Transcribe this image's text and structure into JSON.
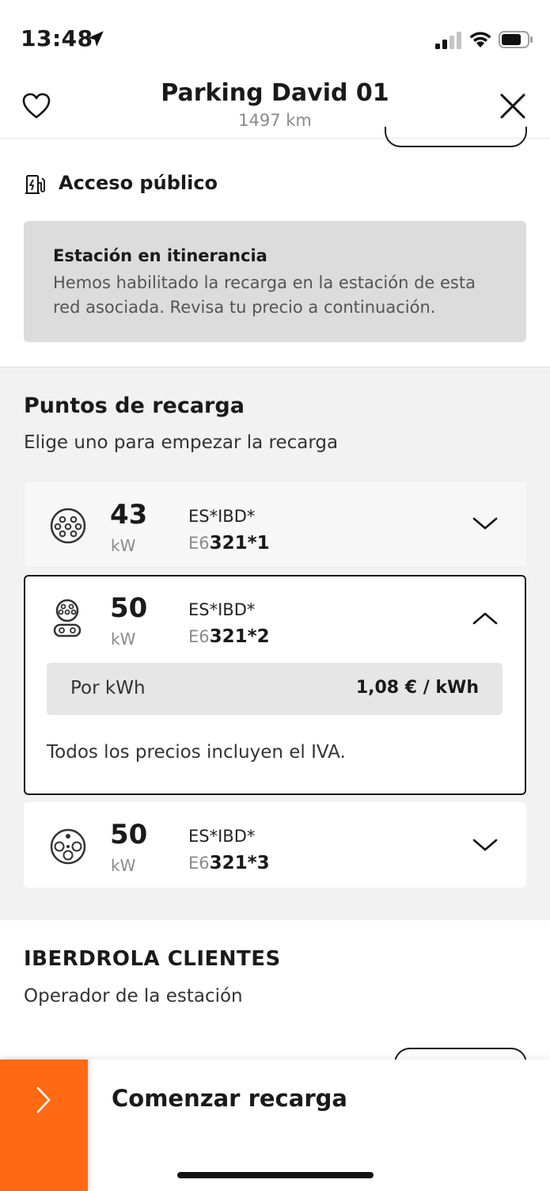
{
  "status_bar": {
    "time": "13:48"
  },
  "header": {
    "title": "Parking David 01",
    "distance": "1497 km"
  },
  "access": {
    "label": "Acceso público"
  },
  "roaming": {
    "title": "Estación en itinerancia",
    "text": "Hemos habilitado la recarga en la estación de esta red asociada. Revisa tu precio a continuación."
  },
  "charge_points": {
    "title": "Puntos de recarga",
    "subtitle": "Elige uno para empezar la recarga",
    "items": [
      {
        "power": "43",
        "unit": "kW",
        "code_top": "ES*IBD*",
        "code_prefix": "E6",
        "code_bold": "321*1",
        "expanded": false,
        "connector_icon": "type2-connector-icon"
      },
      {
        "power": "50",
        "unit": "kW",
        "code_top": "ES*IBD*",
        "code_prefix": "E6",
        "code_bold": "321*2",
        "expanded": true,
        "connector_icon": "ccs-connector-icon"
      },
      {
        "power": "50",
        "unit": "kW",
        "code_top": "ES*IBD*",
        "code_prefix": "E6",
        "code_bold": "321*3",
        "expanded": false,
        "connector_icon": "chademo-connector-icon"
      }
    ],
    "price": {
      "label": "Por kWh",
      "value": "1,08 € / kWh"
    },
    "vat_note": "Todos los precios incluyen el IVA."
  },
  "operator": {
    "name": "IBERDROLA CLIENTES",
    "subtitle": "Operador de la estación"
  },
  "bottom": {
    "start_label": "Comenzar recarga"
  },
  "colors": {
    "accent": "#ff6a13",
    "info_box": "#dcdcdc",
    "section_bg": "#f2f2f2"
  }
}
